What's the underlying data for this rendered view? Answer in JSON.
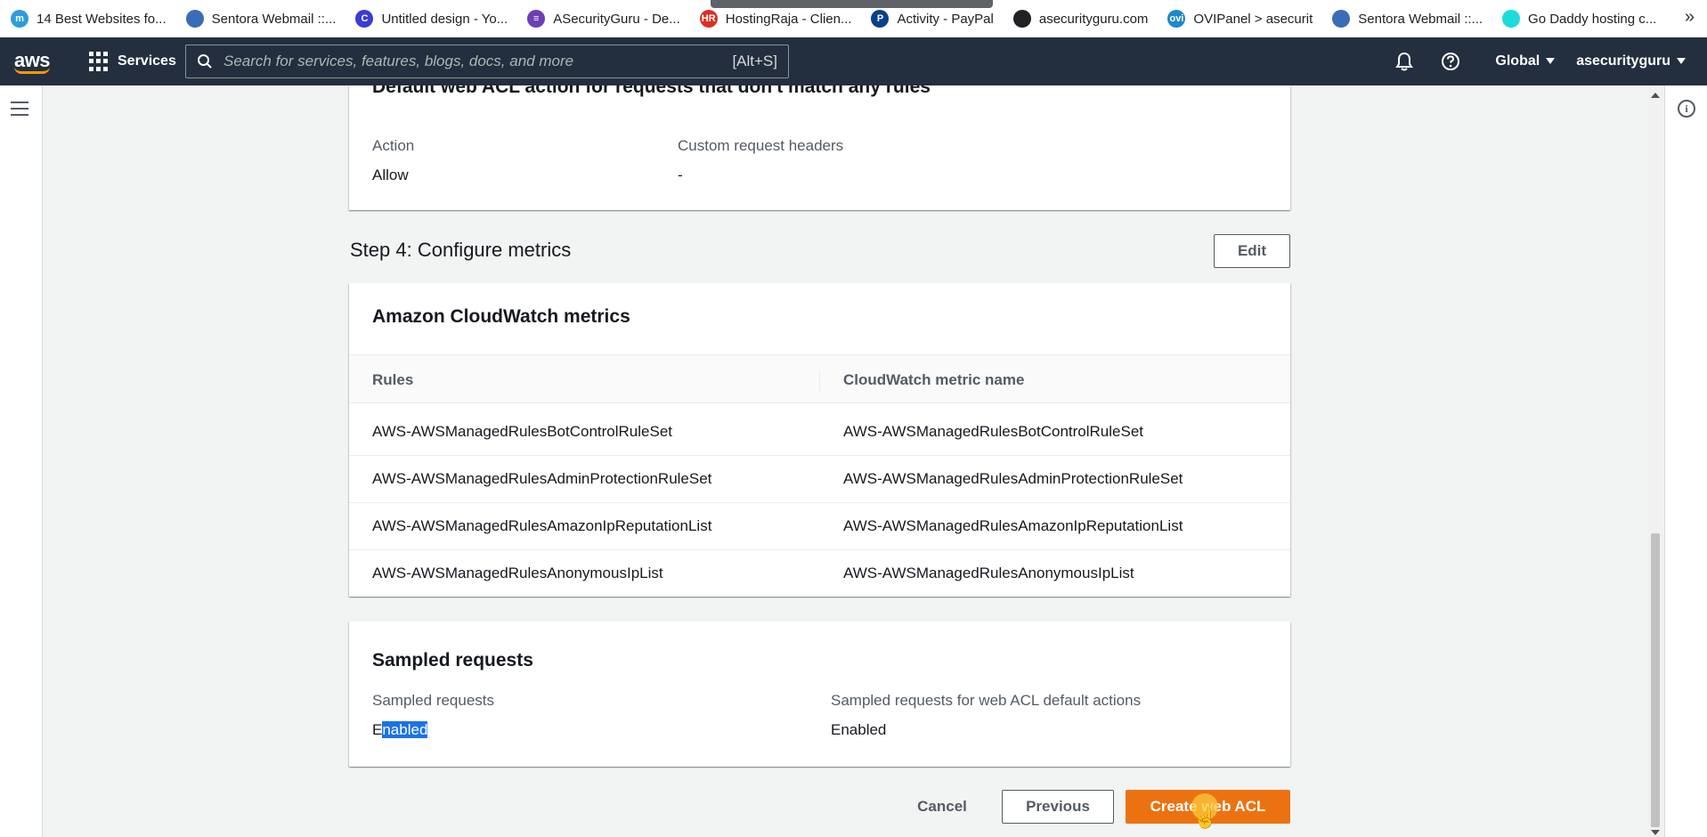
{
  "browser": {
    "bookmarks": [
      {
        "label": "14 Best Websites fo...",
        "icon": "m-circle-icon",
        "color": "#2d9cdb",
        "glyph": "m"
      },
      {
        "label": "Sentora Webmail ::...",
        "icon": "webmail-globe-icon",
        "color": "#3b6cb7",
        "glyph": ""
      },
      {
        "label": "Untitled design - Yo...",
        "icon": "canva-icon",
        "color": "#3b3bd6",
        "glyph": "C"
      },
      {
        "label": "ASecurityGuru - De...",
        "icon": "form-icon",
        "color": "#6c3fb5",
        "glyph": "≡"
      },
      {
        "label": "HostingRaja - Clien...",
        "icon": "hr-logo-icon",
        "color": "#d93025",
        "glyph": "HR"
      },
      {
        "label": "Activity - PayPal",
        "icon": "paypal-icon",
        "color": "#0a3e8a",
        "glyph": "P"
      },
      {
        "label": "asecurityguru.com",
        "icon": "globe-icon",
        "color": "#202124",
        "glyph": ""
      },
      {
        "label": "OVIPanel > asecurit",
        "icon": "ovipanel-icon",
        "color": "#1e88c9",
        "glyph": "ovi"
      },
      {
        "label": "Sentora Webmail ::...",
        "icon": "webmail-globe-icon",
        "color": "#3b6cb7",
        "glyph": ""
      },
      {
        "label": "Go Daddy hosting c...",
        "icon": "godaddy-icon",
        "color": "#1bdbdb",
        "glyph": ""
      }
    ],
    "more": "»"
  },
  "nav": {
    "logo": "aws",
    "services_label": "Services",
    "search_placeholder": "Search for services, features, blogs, docs, and more",
    "search_shortcut": "[Alt+S]",
    "region_label": "Global",
    "account_label": "asecurityguru"
  },
  "default_action_panel": {
    "title_cut": "Default web ACL action for requests that don't match any rules",
    "action_label": "Action",
    "action_value": "Allow",
    "headers_label": "Custom request headers",
    "headers_value": "-"
  },
  "step4": {
    "title": "Step 4: Configure metrics",
    "edit_label": "Edit",
    "panel_title": "Amazon CloudWatch metrics",
    "columns": [
      "Rules",
      "CloudWatch metric name"
    ],
    "rows": [
      {
        "rule": "AWS-AWSManagedRulesBotControlRuleSet",
        "metric": "AWS-AWSManagedRulesBotControlRuleSet"
      },
      {
        "rule": "AWS-AWSManagedRulesAdminProtectionRuleSet",
        "metric": "AWS-AWSManagedRulesAdminProtectionRuleSet"
      },
      {
        "rule": "AWS-AWSManagedRulesAmazonIpReputationList",
        "metric": "AWS-AWSManagedRulesAmazonIpReputationList"
      },
      {
        "rule": "AWS-AWSManagedRulesAnonymousIpList",
        "metric": "AWS-AWSManagedRulesAnonymousIpList"
      }
    ]
  },
  "sampled": {
    "title": "Sampled requests",
    "label1": "Sampled requests",
    "value1_first": "E",
    "value1_rest": "nabled",
    "label2": "Sampled requests for web ACL default actions",
    "value2": "Enabled"
  },
  "footer": {
    "cancel": "Cancel",
    "previous": "Previous",
    "create": "Create web ACL"
  },
  "colors": {
    "nav_bg": "#232f3e",
    "primary_button": "#ec7211",
    "page_bg": "#f2f3f3",
    "selection": "#1a73e8"
  }
}
